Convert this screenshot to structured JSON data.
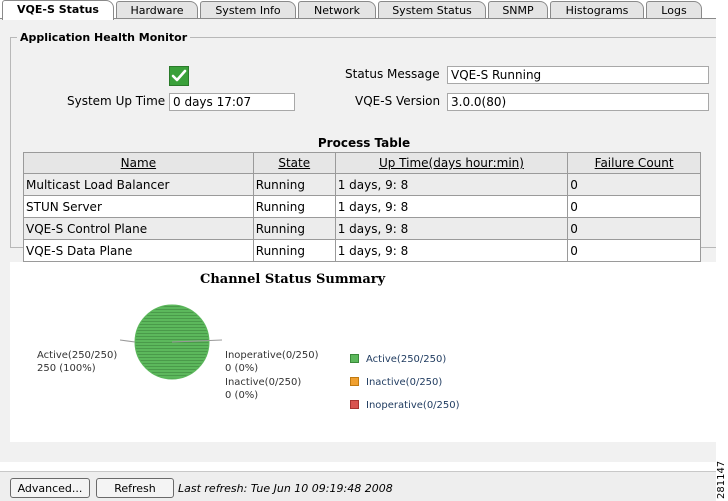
{
  "tabs": [
    {
      "label": "VQE-S Status",
      "active": true
    },
    {
      "label": "Hardware"
    },
    {
      "label": "System Info"
    },
    {
      "label": "Network"
    },
    {
      "label": "System Status"
    },
    {
      "label": "SNMP"
    },
    {
      "label": "Histograms"
    },
    {
      "label": "Logs"
    }
  ],
  "health": {
    "legend": "Application Health Monitor",
    "status_label": "Status Message",
    "status_value": "VQE-S Running",
    "uptime_label": "System Up Time",
    "uptime_value": "0 days 17:07",
    "version_label": "VQE-S Version",
    "version_value": "3.0.0(80)",
    "check_icon": "checkmark-icon"
  },
  "process_table": {
    "title": "Process Table",
    "columns": [
      "Name",
      "State",
      "Up Time(days hour:min)",
      "Failure Count"
    ],
    "rows": [
      [
        "Multicast Load Balancer",
        "Running",
        "1 days, 9: 8",
        "0"
      ],
      [
        "STUN Server",
        "Running",
        "1 days, 9: 8",
        "0"
      ],
      [
        "VQE-S Control Plane",
        "Running",
        "1 days, 9: 8",
        "0"
      ],
      [
        "VQE-S Data Plane",
        "Running",
        "1 days, 9: 8",
        "0"
      ]
    ]
  },
  "chart_data": {
    "type": "pie",
    "title": "Channel Status Summary",
    "slices": [
      {
        "label": "Active",
        "value": 250,
        "total": 250,
        "percent": 100,
        "color": "#5cb85c"
      },
      {
        "label": "Inactive",
        "value": 0,
        "total": 250,
        "percent": 0,
        "color": "#f0a030"
      },
      {
        "label": "Inoperative",
        "value": 0,
        "total": 250,
        "percent": 0,
        "color": "#d9534f"
      }
    ],
    "pie_labels": {
      "active_line1": "Active(250/250)",
      "active_line2": "250 (100%)",
      "inoperative_line1": "Inoperative(0/250)",
      "inoperative_line2": "0 (0%)",
      "inactive_line1": "Inactive(0/250)",
      "inactive_line2": "0 (0%)"
    },
    "legend": [
      "Active(250/250)",
      "Inactive(0/250)",
      "Inoperative(0/250)"
    ],
    "legend_position": "right"
  },
  "footer": {
    "advanced_label": "Advanced...",
    "refresh_label": "Refresh",
    "last_refresh": "Last refresh: Tue Jun 10 09:19:48 2008"
  },
  "figure_code": "281147"
}
